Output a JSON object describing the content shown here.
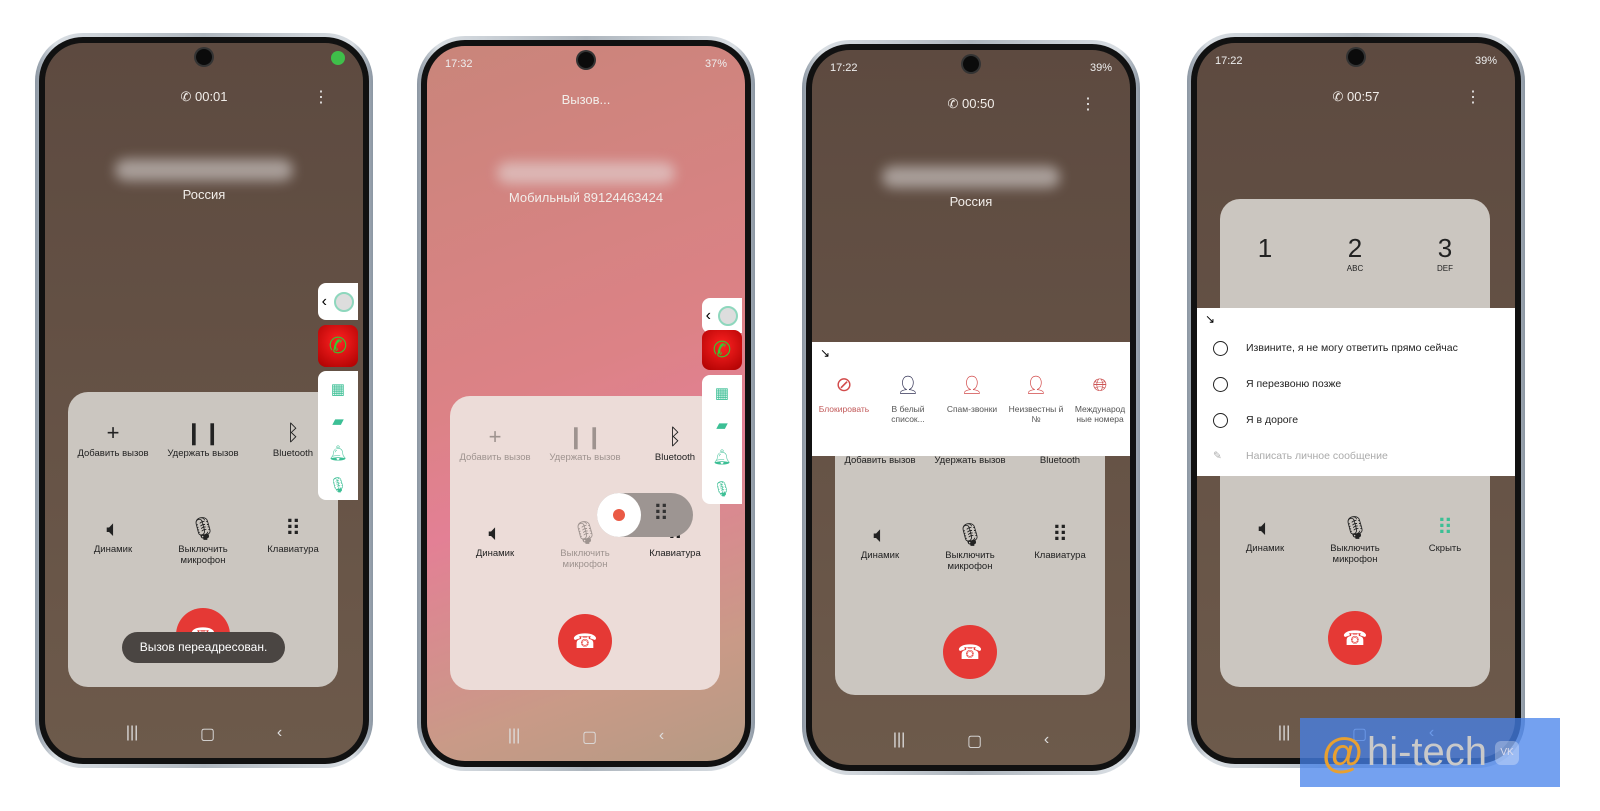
{
  "phones": [
    {
      "timer": "00:01",
      "country": "Россия",
      "buttons": [
        "Добавить вызов",
        "Удержать вызов",
        "Bluetooth",
        "Динамик",
        "Выключить микрофон",
        "Клавиатура"
      ],
      "toast": "Вызов переадресован."
    },
    {
      "status": {
        "time": "17:32",
        "battery": "37%"
      },
      "state": "Вызов...",
      "number": "Мобильный  89124463424",
      "buttons": [
        "Добавить вызов",
        "Удержать вызов",
        "Bluetooth",
        "Динамик",
        "Выключить микрофон",
        "Клавиатура"
      ]
    },
    {
      "status": {
        "time": "17:22",
        "battery": "39%"
      },
      "timer": "00:50",
      "country": "Россия",
      "popup": [
        "Блокировать",
        "В белый список...",
        "Спам-звонки",
        "Неизвестны й №",
        "Международ ные номера"
      ],
      "buttons": [
        "Добавить вызов",
        "Удержать вызов",
        "Bluetooth",
        "Динамик",
        "Выключить микрофон",
        "Клавиатура"
      ]
    },
    {
      "status": {
        "time": "17:22",
        "battery": "39%"
      },
      "timer": "00:57",
      "keys": [
        {
          "d": "1",
          "l": ""
        },
        {
          "d": "2",
          "l": "ABC"
        },
        {
          "d": "3",
          "l": "DEF"
        }
      ],
      "replies": [
        "Извините, я не могу ответить прямо сейчас",
        "Я перезвоню позже",
        "Я в дороге"
      ],
      "custom": "Написать личное сообщение",
      "buttons": [
        "Динамик",
        "Выключить микрофон",
        "Скрыть"
      ]
    }
  ],
  "colors": {
    "accent": "#3cbf95",
    "end_call": "#e53935",
    "block": "#d24b4b"
  },
  "watermark": {
    "text": "hi-tech",
    "at": "@"
  }
}
